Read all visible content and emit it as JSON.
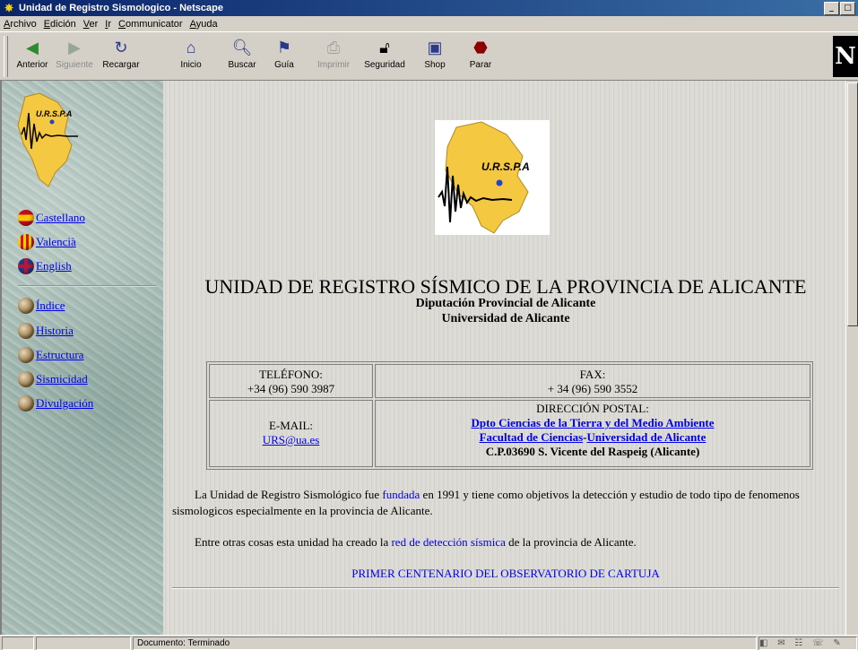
{
  "window": {
    "title": "Unidad de Registro Sismologico - Netscape",
    "buttons": [
      "_",
      "□"
    ]
  },
  "menubar": [
    "Archivo",
    "Edición",
    "Ver",
    "Ir",
    "Communicator",
    "Ayuda"
  ],
  "toolbar": {
    "buttons": [
      {
        "label": "Anterior",
        "icon": "back-arrow-icon",
        "enabled": true
      },
      {
        "label": "Siguiente",
        "icon": "forward-arrow-icon",
        "enabled": false
      },
      {
        "label": "Recargar",
        "icon": "reload-icon",
        "enabled": true
      },
      {
        "label": "Inicio",
        "icon": "home-icon",
        "enabled": true
      },
      {
        "label": "Buscar",
        "icon": "search-icon",
        "enabled": true
      },
      {
        "label": "Guía",
        "icon": "guide-icon",
        "enabled": true
      },
      {
        "label": "Imprimir",
        "icon": "print-icon",
        "enabled": false
      },
      {
        "label": "Seguridad",
        "icon": "security-lock-icon",
        "enabled": true
      },
      {
        "label": "Shop",
        "icon": "shop-icon",
        "enabled": true
      },
      {
        "label": "Parar",
        "icon": "stop-icon",
        "enabled": true
      }
    ],
    "logo": "N"
  },
  "sidebar": {
    "logo_text": "U.R.S.P.A",
    "languages": [
      {
        "label": "Castellano",
        "color": "#d7261b"
      },
      {
        "label": "Valencià",
        "color": "#e8b400"
      },
      {
        "label": "English",
        "color": "#c8102e"
      }
    ],
    "sections": [
      {
        "label": "Índice"
      },
      {
        "label": "Historia"
      },
      {
        "label": "Estructura"
      },
      {
        "label": "Sismicidad"
      },
      {
        "label": "Divulgación"
      }
    ]
  },
  "main": {
    "logo_text": "U.R.S.P.A",
    "heading": "UNIDAD DE REGISTRO SÍSMICO DE LA PROVINCIA DE ALICANTE",
    "subheading1": "Diputación Provincial de Alicante",
    "subheading2": "Universidad de Alicante",
    "contact": {
      "phone_label": "TELÉFONO:",
      "phone_value": "+34  (96) 590 3987",
      "fax_label": "FAX:",
      "fax_value": "+ 34 (96) 590 3552",
      "email_label": "E-MAIL:",
      "email_value": "URS@ua.es",
      "postal_label": "DIRECCIÓN POSTAL:",
      "postal_line1": "Dpto Ciencias de la Tierra y del Medio Ambiente",
      "postal_line2a": "Facultad de Ciencias",
      "postal_line2_sep": "-",
      "postal_line2b": "Universidad de Alicante",
      "postal_line3": "C.P.03690  S. Vicente del Raspeig  (Alicante)"
    },
    "para1_before": "La Unidad de Registro Sismológico fue ",
    "para1_link": "fundada",
    "para1_after": " en 1991 y tiene como objetivos la detección y estudio de todo tipo de fenomenos sismologicos especialmente en la provincia de Alicante.",
    "para2_before": "Entre otras cosas esta unidad ha creado la ",
    "para2_link": "red de detección sísmica",
    "para2_after": " de la provincia de Alicante.",
    "centenario_link": "PRIMER CENTENARIO DEL OBSERVATORIO DE CARTUJA"
  },
  "statusbar": {
    "text": "Documento: Terminado"
  }
}
